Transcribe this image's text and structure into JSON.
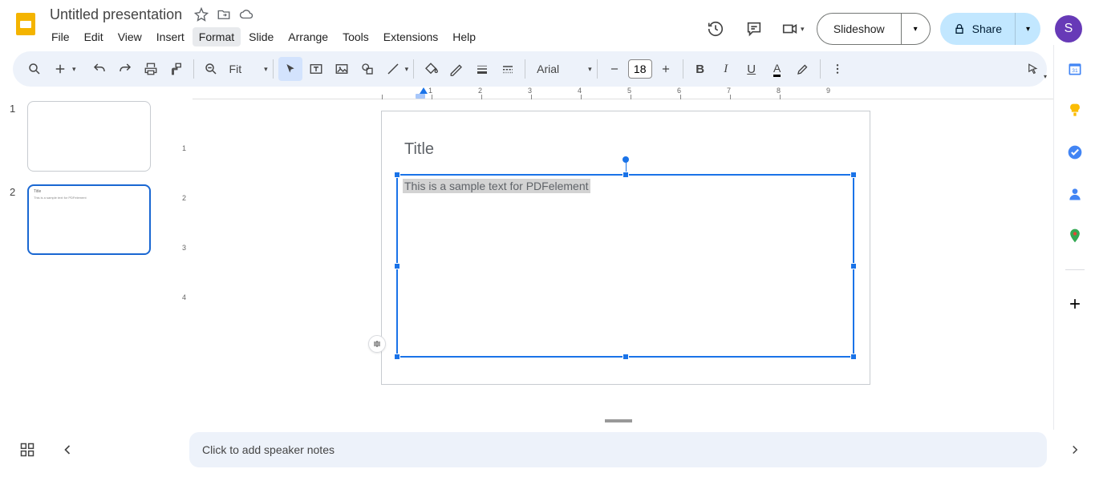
{
  "doc_title": "Untitled presentation",
  "menu": [
    "File",
    "Edit",
    "View",
    "Insert",
    "Format",
    "Slide",
    "Arrange",
    "Tools",
    "Extensions",
    "Help"
  ],
  "active_menu": 4,
  "slideshow_label": "Slideshow",
  "share_label": "Share",
  "avatar_letter": "S",
  "zoom_label": "Fit",
  "font_name": "Arial",
  "font_size": "18",
  "thumbnails": [
    {
      "num": "1",
      "selected": false,
      "title": "",
      "body": ""
    },
    {
      "num": "2",
      "selected": true,
      "title": "Title",
      "body": "This is a sample text for PDFelement"
    }
  ],
  "slide_title": "Title",
  "slide_body": "This is a sample text for PDFelement",
  "ruler_nums": [
    "1",
    "2",
    "3",
    "4",
    "5",
    "6",
    "7",
    "8",
    "9"
  ],
  "vruler_nums": [
    "1",
    "2",
    "3",
    "4"
  ],
  "notes_placeholder": "Click to add speaker notes",
  "calendar_day": "31"
}
